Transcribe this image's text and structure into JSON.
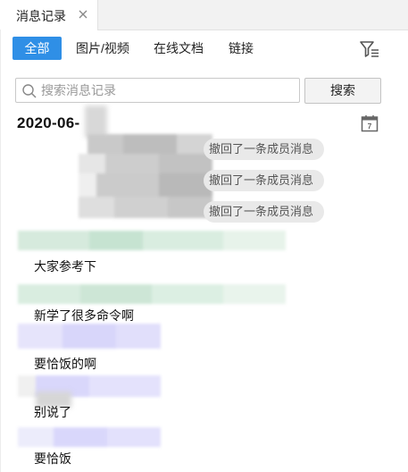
{
  "tab": {
    "title": "消息记录"
  },
  "filters": [
    {
      "label": "全部",
      "active": true
    },
    {
      "label": "图片/视频",
      "active": false
    },
    {
      "label": "在线文档",
      "active": false
    },
    {
      "label": "链接",
      "active": false
    }
  ],
  "search": {
    "placeholder": "搜索消息记录",
    "value": "",
    "button_label": "搜索"
  },
  "date": "2020-06-",
  "recalls": [
    {
      "text": "撤回了一条成员消息"
    },
    {
      "text": "撤回了一条成员消息"
    },
    {
      "text": "撤回了一条成员消息"
    }
  ],
  "messages": [
    {
      "text": "大家参考下"
    },
    {
      "text": "新学了很多命令啊"
    },
    {
      "text": "要恰饭的啊"
    },
    {
      "text": "别说了"
    },
    {
      "text": "要恰饭"
    }
  ],
  "colors": {
    "accent": "#2f8fe6",
    "pill_bg": "#e9e9e9",
    "blur_green": "#cfe8d9",
    "blur_purple": "#dedcfa",
    "blur_gray": "#cfcfcf"
  }
}
